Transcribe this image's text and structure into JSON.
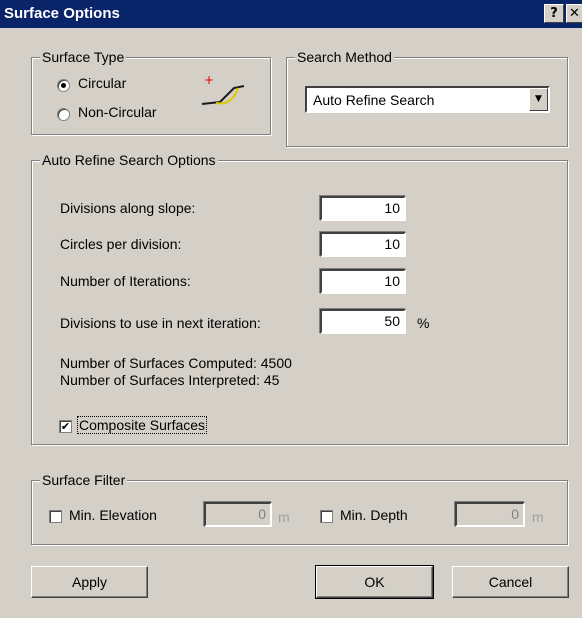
{
  "window": {
    "title": "Surface Options",
    "help_button": "?",
    "close_button": "✕"
  },
  "surface_type": {
    "legend": "Surface Type",
    "options": [
      {
        "label": "Circular",
        "selected": true
      },
      {
        "label": "Non-Circular",
        "selected": false
      }
    ]
  },
  "search_method": {
    "legend": "Search Method",
    "selected": "Auto Refine Search"
  },
  "auto_refine": {
    "legend": "Auto Refine Search Options",
    "fields": [
      {
        "label": "Divisions along slope:",
        "value": "10",
        "unit": ""
      },
      {
        "label": "Circles per division:",
        "value": "10",
        "unit": ""
      },
      {
        "label": "Number of Iterations:",
        "value": "10",
        "unit": ""
      },
      {
        "label": "Divisions to use in next iteration:",
        "value": "50",
        "unit": "%"
      }
    ],
    "computed": "Number of Surfaces Computed: 4500",
    "interpreted": "Number of Surfaces Interpreted: 45",
    "composite": {
      "label": "Composite Surfaces",
      "checked": true
    }
  },
  "surface_filter": {
    "legend": "Surface Filter",
    "min_elevation": {
      "label": "Min. Elevation",
      "checked": false,
      "value": "0",
      "unit": "m"
    },
    "min_depth": {
      "label": "Min. Depth",
      "checked": false,
      "value": "0",
      "unit": "m"
    }
  },
  "buttons": {
    "apply": "Apply",
    "ok": "OK",
    "cancel": "Cancel"
  },
  "colors": {
    "title_bar": "#0a246a",
    "dialog_face": "#d4d0c8",
    "icon_slope": "#1a1a1a",
    "icon_arc": "#e0c800",
    "icon_center": "#e00000"
  }
}
